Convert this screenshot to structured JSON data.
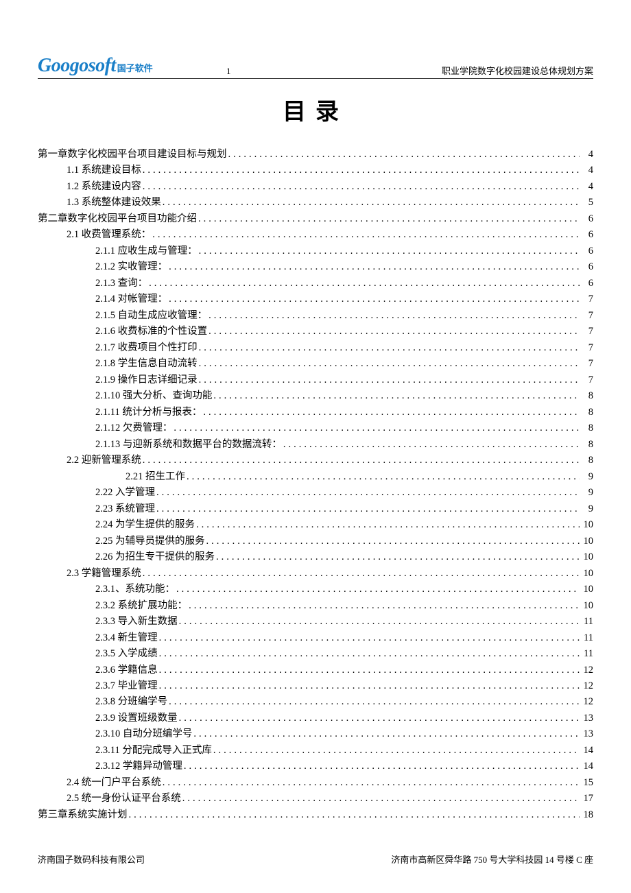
{
  "header": {
    "logo_main": "Googosoft",
    "logo_sub": "国子软件",
    "page_num": "1",
    "doc_title": "职业学院数字化校园建设总体规划方案"
  },
  "title": "目录",
  "toc": [
    {
      "level": 1,
      "label": "第一章数字化校园平台项目建设目标与规划",
      "page": "4"
    },
    {
      "level": 2,
      "label": "1.1 系统建设目标",
      "page": "4"
    },
    {
      "level": 2,
      "label": "1.2 系统建设内容",
      "page": "4"
    },
    {
      "level": 2,
      "label": "1.3 系统整体建设效果",
      "page": "5"
    },
    {
      "level": 1,
      "label": "第二章数字化校园平台项目功能介绍",
      "page": "6"
    },
    {
      "level": 2,
      "label": "2.1 收费管理系统：",
      "page": "6"
    },
    {
      "level": 3,
      "label": "2.1.1 应收生成与管理：",
      "page": "6"
    },
    {
      "level": 3,
      "label": "2.1.2 实收管理：",
      "page": "6"
    },
    {
      "level": 3,
      "label": "2.1.3 查询：",
      "page": "6"
    },
    {
      "level": 3,
      "label": "2.1.4 对帐管理：",
      "page": "7"
    },
    {
      "level": 3,
      "label": "2.1.5 自动生成应收管理：",
      "page": "7"
    },
    {
      "level": 3,
      "label": "2.1.6 收费标准的个性设置",
      "page": "7"
    },
    {
      "level": 3,
      "label": "2.1.7 收费项目个性打印",
      "page": "7"
    },
    {
      "level": 3,
      "label": "2.1.8 学生信息自动流转",
      "page": "7"
    },
    {
      "level": 3,
      "label": "2.1.9 操作日志详细记录",
      "page": "7"
    },
    {
      "level": 3,
      "label": "2.1.10 强大分析、查询功能",
      "page": "8"
    },
    {
      "level": 3,
      "label": "2.1.11 统计分析与报表：",
      "page": "8"
    },
    {
      "level": 3,
      "label": "2.1.12 欠费管理：",
      "page": "8"
    },
    {
      "level": 3,
      "label": "2.1.13 与迎新系统和数据平台的数据流转：",
      "page": "8"
    },
    {
      "level": 2,
      "label": "2.2 迎新管理系统",
      "page": "8"
    },
    {
      "level": "3b",
      "label": "2.21 招生工作",
      "page": "9"
    },
    {
      "level": 3,
      "label": "2.22 入学管理",
      "page": "9"
    },
    {
      "level": 3,
      "label": "2.23 系统管理",
      "page": "9"
    },
    {
      "level": 3,
      "label": "2.24 为学生提供的服务",
      "page": "10"
    },
    {
      "level": 3,
      "label": "2.25 为辅导员提供的服务",
      "page": "10"
    },
    {
      "level": 3,
      "label": "2.26 为招生专干提供的服务",
      "page": "10"
    },
    {
      "level": 2,
      "label": "2.3 学籍管理系统",
      "page": "10"
    },
    {
      "level": 3,
      "label": "2.3.1、系统功能：",
      "page": "10"
    },
    {
      "level": 3,
      "label": "2.3.2 系统扩展功能：",
      "page": "10"
    },
    {
      "level": 3,
      "label": "2.3.3 导入新生数据",
      "page": "11"
    },
    {
      "level": 3,
      "label": "2.3.4 新生管理",
      "page": "11"
    },
    {
      "level": 3,
      "label": "2.3.5 入学成绩",
      "page": "11"
    },
    {
      "level": 3,
      "label": "2.3.6 学籍信息",
      "page": "12"
    },
    {
      "level": 3,
      "label": "2.3.7 毕业管理",
      "page": "12"
    },
    {
      "level": 3,
      "label": "2.3.8 分班编学号",
      "page": "12"
    },
    {
      "level": 3,
      "label": "2.3.9 设置班级数量",
      "page": "13"
    },
    {
      "level": 3,
      "label": "2.3.10 自动分班编学号",
      "page": "13"
    },
    {
      "level": 3,
      "label": "2.3.11 分配完成导入正式库",
      "page": "14"
    },
    {
      "level": 3,
      "label": "2.3.12 学籍异动管理",
      "page": "14"
    },
    {
      "level": 2,
      "label": "2.4 统一门户平台系统",
      "page": "15"
    },
    {
      "level": 2,
      "label": "2.5 统一身份认证平台系统",
      "page": "17"
    },
    {
      "level": 1,
      "label": "第三章系统实施计划",
      "page": "18"
    }
  ],
  "footer": {
    "left": "济南国子数码科技有限公司",
    "right": "济南市高新区舜华路 750 号大学科技园 14 号楼 C 座"
  }
}
